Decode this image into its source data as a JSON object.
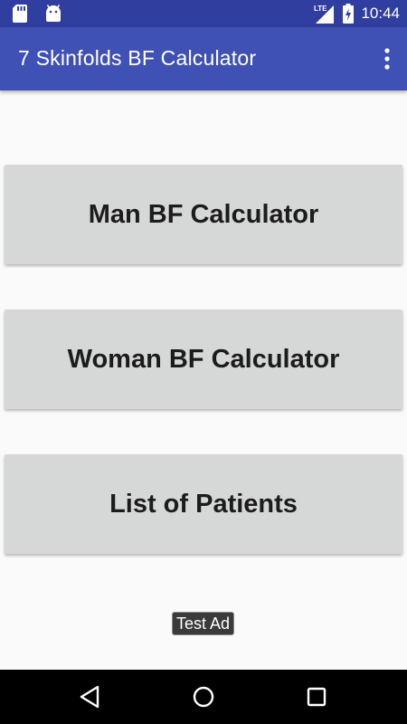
{
  "status_bar": {
    "time": "10:44",
    "network": "LTE",
    "left_icons": [
      "sd-card-icon",
      "android-icon"
    ],
    "right_icons": [
      "lte-signal-icon",
      "battery-charging-icon"
    ]
  },
  "toolbar": {
    "title": "7 Skinfolds BF Calculator",
    "overflow_icon": "more-vert-icon",
    "color": "#3f51b5",
    "status_color": "#303f9f"
  },
  "buttons": [
    {
      "label": "Man BF Calculator"
    },
    {
      "label": "Woman BF Calculator"
    },
    {
      "label": "List of Patients"
    }
  ],
  "ad": {
    "label": "Test Ad"
  },
  "nav_bar": {
    "icons": [
      "back-icon",
      "home-icon",
      "recents-icon"
    ]
  }
}
